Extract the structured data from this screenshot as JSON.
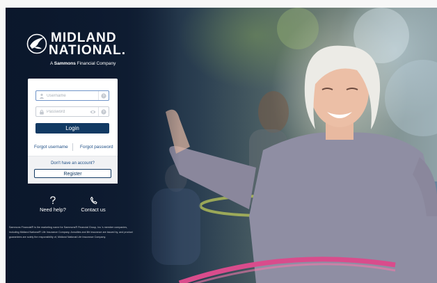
{
  "brand": {
    "line1": "MIDLAND",
    "line2": "NATIONAL.",
    "tagline_prefix": "A ",
    "tagline_bold": "Sammons",
    "tagline_suffix": " Financial Company"
  },
  "login": {
    "username_placeholder": "Username",
    "password_placeholder": "Password",
    "login_label": "Login",
    "forgot_username": "Forgot username",
    "forgot_password": "Forgot password",
    "no_account": "Don't have an account?",
    "register_label": "Register"
  },
  "help": {
    "need_help": "Need help?",
    "contact_us": "Contact us"
  },
  "disclaimer": [
    "Sammons Financial® is the marketing name for Sammons® Financial Group, Inc.'s member companies,",
    "including Midland National® Life Insurance Company. Annuities and life insurance are issued by, and product",
    "guarantees are solely the responsibility of, Midland National Life Insurance Company."
  ],
  "colors": {
    "primary": "#123a63",
    "link": "#1f4f86",
    "overlay": "#0f1d33",
    "hoop": "#d94c8c"
  }
}
